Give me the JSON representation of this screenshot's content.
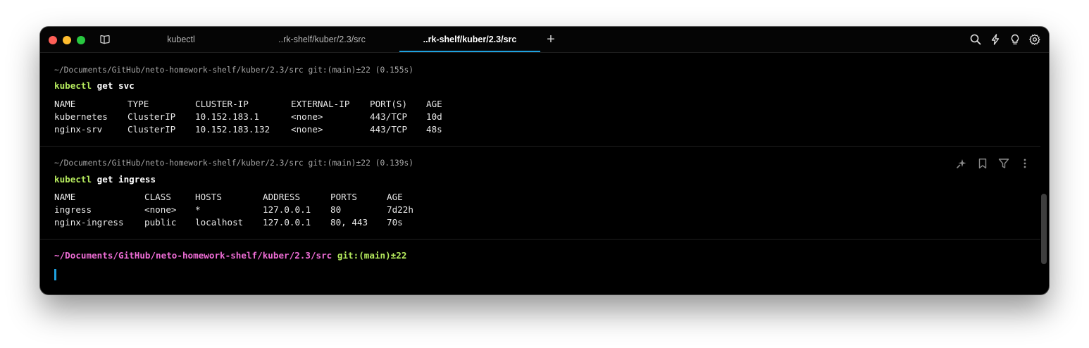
{
  "window": {
    "tabs": [
      {
        "label": "kubectl",
        "active": false
      },
      {
        "label": "..rk-shelf/kuber/2.3/src",
        "active": false
      },
      {
        "label": "..rk-shelf/kuber/2.3/src",
        "active": true
      }
    ],
    "new_tab_label": "+",
    "toolbar_icons": [
      "search-icon",
      "bolt-icon",
      "lightbulb-icon",
      "gear-icon"
    ]
  },
  "blocks": [
    {
      "path_line": "~/Documents/GitHub/neto-homework-shelf/kuber/2.3/src git:(main)±22 (0.155s)",
      "command": {
        "name": "kubectl",
        "args": " get svc"
      },
      "columns": [
        "NAME",
        "TYPE",
        "CLUSTER-IP",
        "EXTERNAL-IP",
        "PORT(S)",
        "AGE"
      ],
      "rows": [
        [
          "kubernetes",
          "ClusterIP",
          "10.152.183.1",
          "<none>",
          "443/TCP",
          "10d"
        ],
        [
          "nginx-srv",
          "ClusterIP",
          "10.152.183.132",
          "<none>",
          "443/TCP",
          "48s"
        ]
      ]
    },
    {
      "path_line": "~/Documents/GitHub/neto-homework-shelf/kuber/2.3/src git:(main)±22 (0.139s)",
      "command": {
        "name": "kubectl",
        "args": " get ingress"
      },
      "columns": [
        "NAME",
        "CLASS",
        "HOSTS",
        "ADDRESS",
        "PORTS",
        "AGE"
      ],
      "rows": [
        [
          "ingress",
          "<none>",
          "*",
          "127.0.0.1",
          "80",
          "7d22h"
        ],
        [
          "nginx-ingress",
          "public",
          "localhost",
          "127.0.0.1",
          "80, 443",
          "70s"
        ]
      ],
      "action_icons": [
        "sparkle-icon",
        "bookmark-icon",
        "filter-icon",
        "more-icon"
      ]
    }
  ],
  "prompt": {
    "path": "~/Documents/GitHub/neto-homework-shelf/kuber/2.3/src",
    "git": " git:(main)±22"
  },
  "colors": {
    "accent": "#1ea1df",
    "command": "#b5ea5d",
    "prompt_path": "#ef6dd6"
  }
}
